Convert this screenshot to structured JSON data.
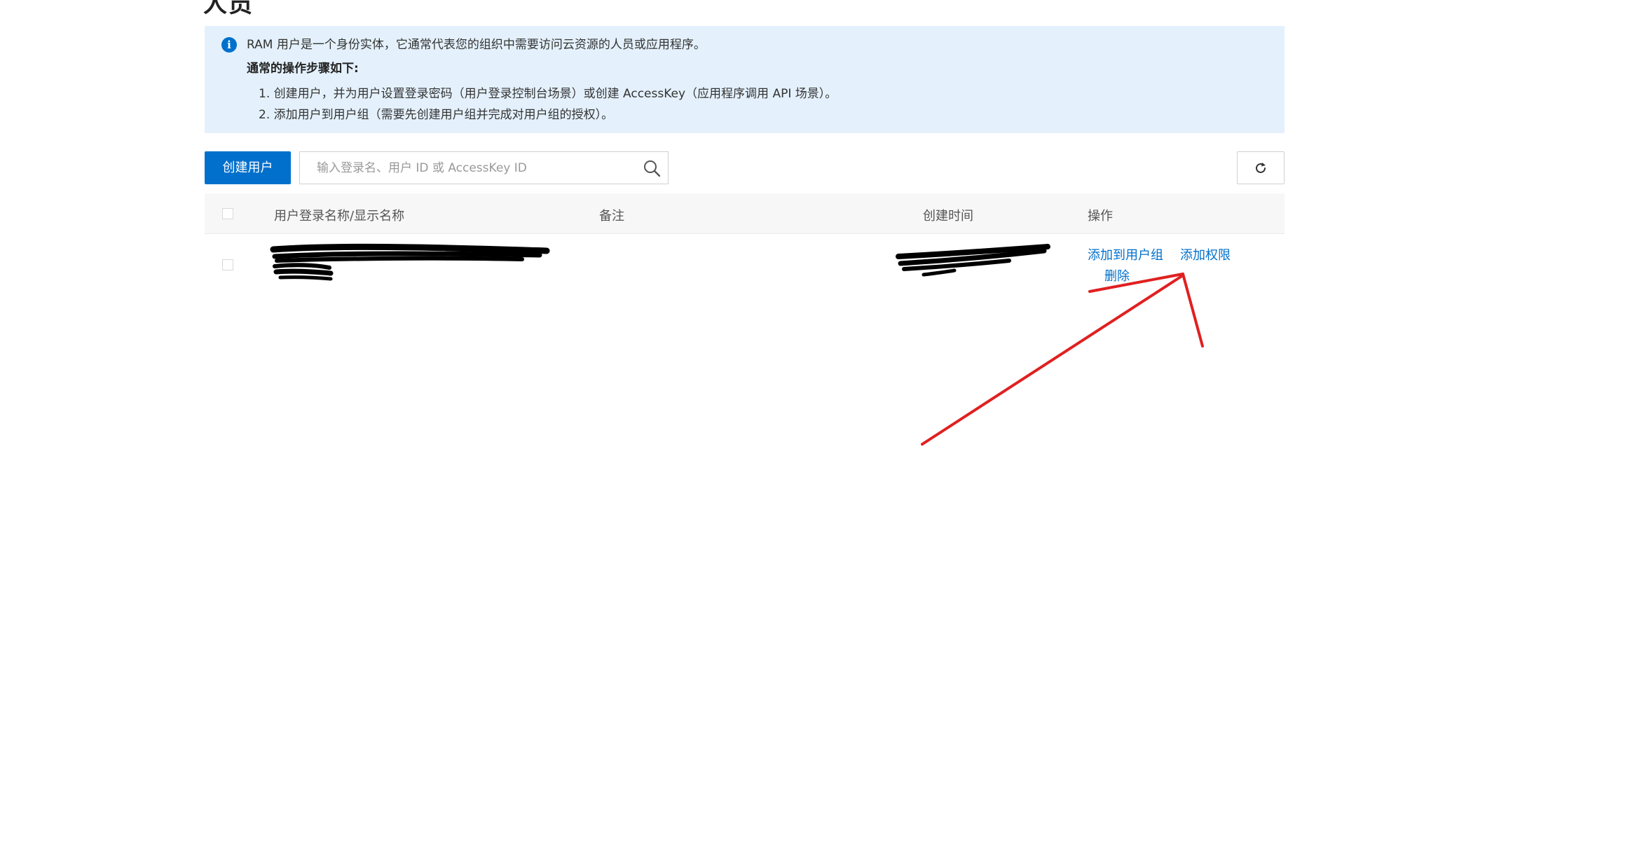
{
  "page": {
    "cut_title": "人员"
  },
  "info": {
    "icon": "info-icon",
    "intro": "RAM 用户是一个身份实体，它通常代表您的组织中需要访问云资源的人员或应用程序。",
    "steps_title": "通常的操作步骤如下:",
    "step1": "1. 创建用户，并为用户设置登录密码（用户登录控制台场景）或创建 AccessKey（应用程序调用 API 场景）。",
    "step2": "2. 添加用户到用户组（需要先创建用户组并完成对用户组的授权）。"
  },
  "toolbar": {
    "create_user_label": "创建用户",
    "search_placeholder": "输入登录名、用户 ID 或 AccessKey ID",
    "search_value": "",
    "refresh_icon": "refresh-icon"
  },
  "table": {
    "headers": [
      "用户登录名称/显示名称",
      "备注",
      "创建时间",
      "操作"
    ],
    "rows": [
      {
        "name": "",
        "remark": "",
        "created": "",
        "actions": [
          "添加到用户组",
          "添加权限",
          "删除"
        ]
      }
    ]
  },
  "colors": {
    "primary": "#0070cc",
    "info_bg": "#e4f1fc",
    "annotation": "#e02020"
  }
}
